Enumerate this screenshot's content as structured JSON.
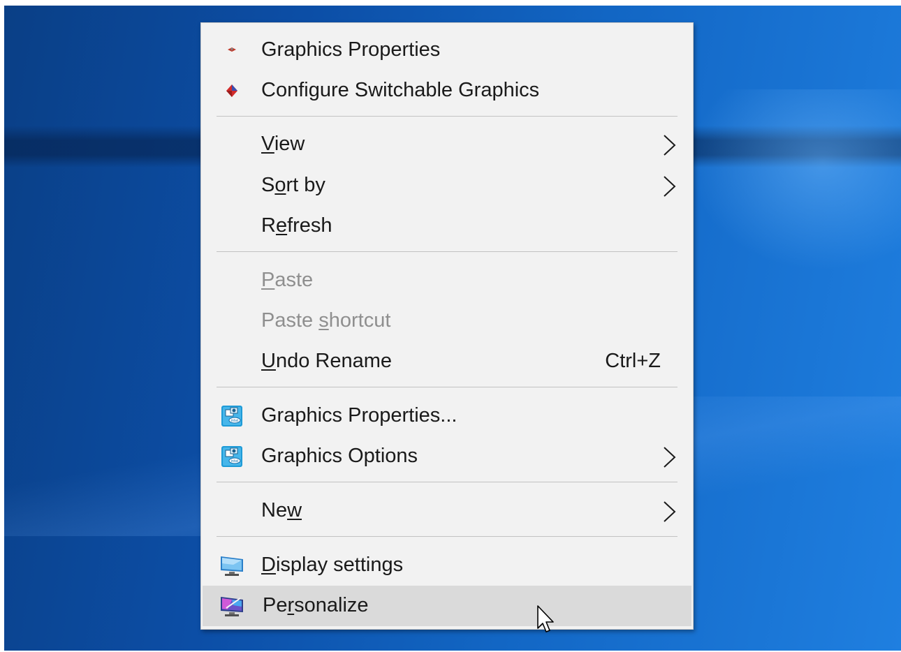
{
  "menu": {
    "items": [
      {
        "label": "Graphics Properties",
        "icon": "amd-small-icon"
      },
      {
        "label": "Configure Switchable Graphics",
        "icon": "amd-diamond-icon"
      },
      {
        "label_pre": "",
        "label_u": "V",
        "label_post": "iew",
        "submenu": true
      },
      {
        "label_pre": "S",
        "label_u": "o",
        "label_post": "rt by",
        "submenu": true
      },
      {
        "label_pre": "R",
        "label_u": "e",
        "label_post": "fresh"
      },
      {
        "label_pre": "",
        "label_u": "P",
        "label_post": "aste",
        "disabled": true
      },
      {
        "label_pre": "Paste ",
        "label_u": "s",
        "label_post": "hortcut",
        "disabled": true
      },
      {
        "label_pre": "",
        "label_u": "U",
        "label_post": "ndo Rename",
        "shortcut": "Ctrl+Z"
      },
      {
        "label": "Graphics Properties...",
        "icon": "intel-graphics-icon"
      },
      {
        "label": "Graphics Options",
        "icon": "intel-graphics-icon",
        "submenu": true
      },
      {
        "label_pre": "Ne",
        "label_u": "w",
        "label_post": "",
        "submenu": true
      },
      {
        "label_pre": "",
        "label_u": "D",
        "label_post": "isplay settings",
        "icon": "display-monitor-icon"
      },
      {
        "label_pre": "Pe",
        "label_u": "r",
        "label_post": "sonalize",
        "icon": "personalize-monitor-icon",
        "highlighted": true
      }
    ]
  },
  "colors": {
    "menu_bg": "#f2f2f2",
    "highlight": "#dadada",
    "disabled_text": "#8f8f8f",
    "desktop_blue": "#0c4ea6"
  }
}
